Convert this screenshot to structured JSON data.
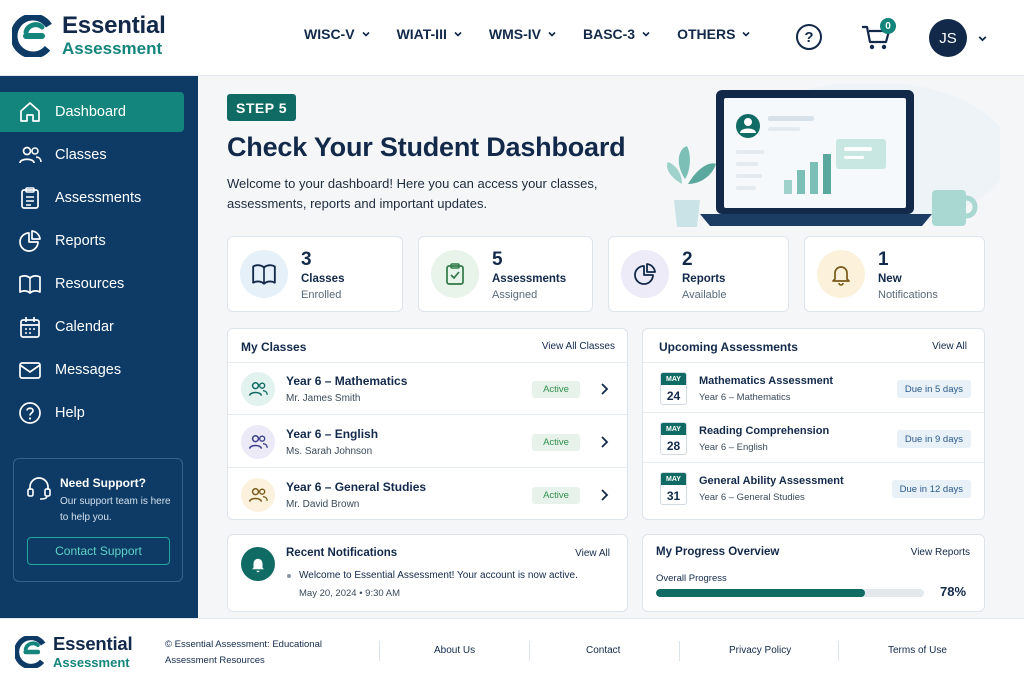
{
  "brand": {
    "name": "Essential",
    "sub": "Assessment",
    "primary": "#0d3b66",
    "accent": "#14857c"
  },
  "nav": {
    "items": [
      "WISC-V",
      "WIAT-III",
      "WMS-IV",
      "BASC-3",
      "OTHERS"
    ],
    "help_icon": "question-circle-icon",
    "cart_icon": "cart-icon",
    "cart_count": "0",
    "user_initials": "JS"
  },
  "sidebar": {
    "items": [
      {
        "label": "Dashboard",
        "icon": "home-icon",
        "active": true
      },
      {
        "label": "Classes",
        "icon": "users-icon"
      },
      {
        "label": "Assessments",
        "icon": "clipboard-icon"
      },
      {
        "label": "Reports",
        "icon": "pie-chart-icon"
      },
      {
        "label": "Resources",
        "icon": "book-icon"
      },
      {
        "label": "Calendar",
        "icon": "calendar-icon"
      },
      {
        "label": "Messages",
        "icon": "mail-icon"
      },
      {
        "label": "Help",
        "icon": "help-icon"
      }
    ],
    "support": {
      "title": "Need Support?",
      "text": "Our support team is here to help you.",
      "button": "Contact Support"
    }
  },
  "main": {
    "step": "STEP 5",
    "title": "Check Your Student Dashboard",
    "description": "Welcome to your dashboard! Here you can access your classes, assessments, reports and important updates.",
    "stats": [
      {
        "value": "3",
        "label": "Classes",
        "sub": "Enrolled",
        "icon": "book-open-icon",
        "color": "#e6f0f8"
      },
      {
        "value": "5",
        "label": "Assessments",
        "sub": "Assigned",
        "icon": "clipboard-check-icon",
        "color": "#e8f3ea"
      },
      {
        "value": "2",
        "label": "Reports",
        "sub": "Available",
        "icon": "pie-chart-icon",
        "color": "#ecebf7"
      },
      {
        "value": "1",
        "label": "New",
        "sub": "Notifications",
        "icon": "bell-icon",
        "color": "#fcf2dc"
      }
    ],
    "classes": {
      "title": "My Classes",
      "link": "View All Classes",
      "items": [
        {
          "name": "Year 6 – Mathematics",
          "teacher": "Mr. James Smith",
          "status": "Active",
          "color": "#e2f2ef"
        },
        {
          "name": "Year 6 – English",
          "teacher": "Ms. Sarah Johnson",
          "status": "Active",
          "color": "#ebeaf6"
        },
        {
          "name": "Year 6 – General Studies",
          "teacher": "Mr. David Brown",
          "status": "Active",
          "color": "#fcf1dc"
        }
      ]
    },
    "assessments": {
      "title": "Upcoming Assessments",
      "link": "View All",
      "items": [
        {
          "month": "MAY",
          "day": "24",
          "name": "Mathematics Assessment",
          "sub": "Year 6 – Mathematics",
          "due": "Due in 5 days"
        },
        {
          "month": "MAY",
          "day": "28",
          "name": "Reading Comprehension",
          "sub": "Year 6 – English",
          "due": "Due in 9 days"
        },
        {
          "month": "MAY",
          "day": "31",
          "name": "General Ability Assessment",
          "sub": "Year 6 – General Studies",
          "due": "Due in 12 days"
        }
      ]
    },
    "notifications": {
      "title": "Recent Notifications",
      "link": "View All",
      "message": "Welcome to Essential Assessment! Your account is now active.",
      "time": "May 20, 2024  •  9:30 AM"
    },
    "progress": {
      "title": "My Progress Overview",
      "link": "View Reports",
      "label": "Overall Progress",
      "value": 78,
      "display": "78%"
    }
  },
  "footer": {
    "copyright": "© Essential Assessment: Educational Assessment Resources",
    "links": [
      "About Us",
      "Contact",
      "Privacy Policy",
      "Terms of Use"
    ]
  }
}
